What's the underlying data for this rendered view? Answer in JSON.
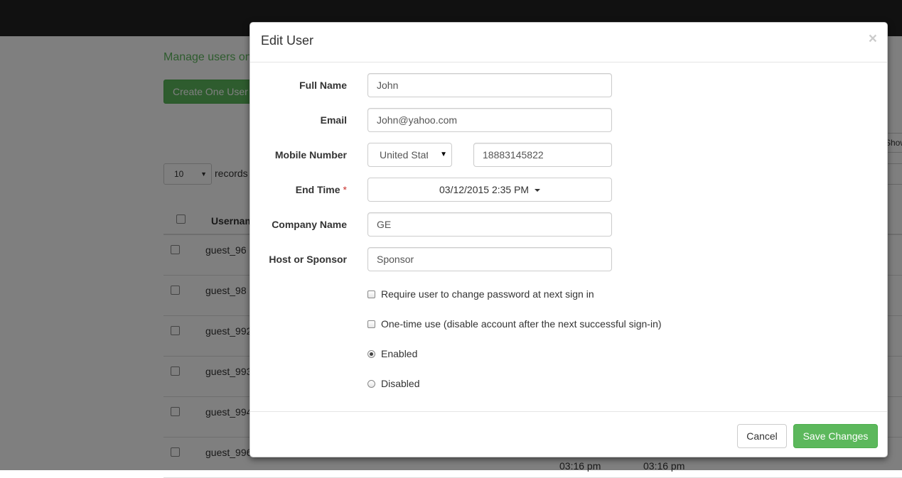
{
  "background": {
    "manage_text": "Manage users on",
    "create_button": "Create One User",
    "show_button": "Show",
    "page_size": "10",
    "records_label": "records",
    "table_header": "Usernam",
    "rows": [
      "guest_96",
      "guest_98",
      "guest_992",
      "guest_993",
      "guest_994",
      "guest_996"
    ],
    "time_1": "03:16 pm",
    "time_2": "03:16 pm"
  },
  "modal": {
    "title": "Edit User",
    "close": "×",
    "fields": {
      "full_name": {
        "label": "Full Name",
        "value": "John"
      },
      "email": {
        "label": "Email",
        "value": "John@yahoo.com"
      },
      "mobile": {
        "label": "Mobile Number",
        "country": "United States",
        "value": "18883145822"
      },
      "end_time": {
        "label": "End Time",
        "required": "*",
        "value": "03/12/2015 2:35 PM"
      },
      "company": {
        "label": "Company Name",
        "value": "GE"
      },
      "host": {
        "label": "Host or Sponsor",
        "value": "Sponsor"
      }
    },
    "options": {
      "require_change": "Require user to change password at next sign in",
      "one_time": "One-time use (disable account after the next successful sign-in)",
      "enabled": "Enabled",
      "disabled": "Disabled"
    },
    "status_selected": "enabled",
    "buttons": {
      "cancel": "Cancel",
      "save": "Save Changes"
    }
  },
  "colors": {
    "accent_green": "#5cb85c",
    "required_red": "#c9302c",
    "topbar": "#222222"
  }
}
